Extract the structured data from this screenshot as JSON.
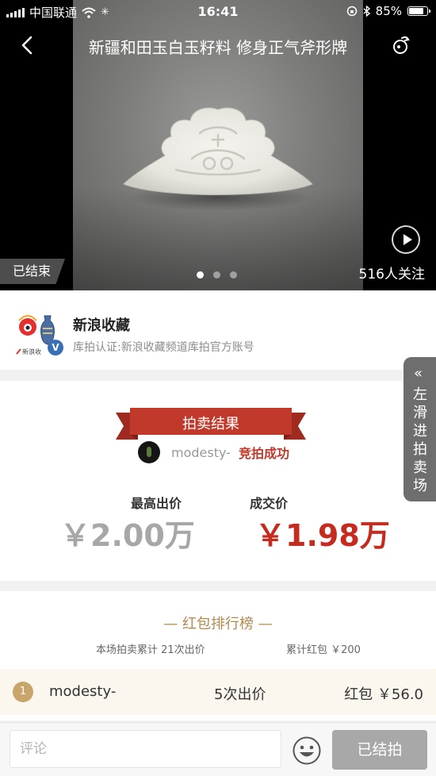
{
  "status_bar": {
    "carrier": "中国联通",
    "time": "16:41",
    "battery": "85%",
    "battery_level": 0.85
  },
  "header": {
    "title": "新疆和田玉白玉籽料 修身正气斧形牌"
  },
  "media": {
    "ended_tag": "已结束",
    "followers": "516人关注",
    "carousel_total": 3,
    "carousel_active": 1
  },
  "seller": {
    "name": "新浪收藏",
    "certification": "库拍认证:新浪收藏频道库拍官方账号",
    "logo_text": "新浪收",
    "verified_badge": "V"
  },
  "side_tab": {
    "arrow": "«",
    "label": "左滑进拍卖场"
  },
  "result": {
    "ribbon_label": "拍卖结果",
    "winner_name": "modesty-",
    "winner_status": "竞拍成功",
    "highest_bid_label": "最高出价",
    "highest_bid_value": "￥2.00万",
    "deal_price_label": "成交价",
    "deal_price_value": "￥1.98万"
  },
  "ranking": {
    "title": "— 红包排行榜 —",
    "total_bids": "本场拍卖累计 21次出价",
    "total_bonus": "累计红包 ￥200",
    "rows": [
      {
        "rank": "1",
        "name": "modesty-",
        "bids": "5次出价",
        "bonus": "红包 ￥56.0"
      }
    ]
  },
  "bottom_bar": {
    "comment_placeholder": "评论",
    "action_label": "已结拍"
  },
  "colors": {
    "accent_red": "#c62b20",
    "ribbon_red": "#c0392b",
    "gold": "#b38a4e",
    "swipe_tab": "#6e6e6e"
  },
  "icons": {
    "back": "chevron-left-icon",
    "share": "share-icon",
    "play": "play-icon",
    "emoji": "emoji-icon",
    "wifi": "wifi-icon",
    "bluetooth": "bluetooth-icon",
    "lock_rotation": "rotation-lock-icon"
  }
}
